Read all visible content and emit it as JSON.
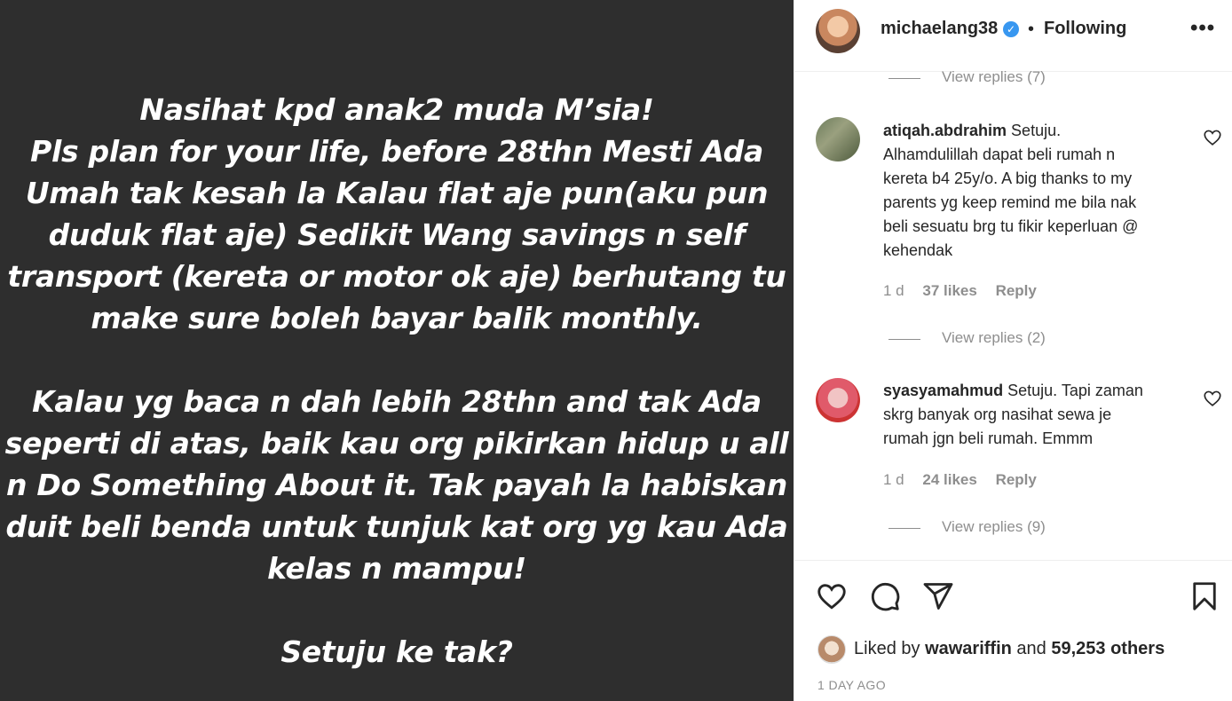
{
  "story": {
    "lines_1": [
      "Nasihat kpd anak2 muda M’sia!",
      "Pls plan for your life, before 28thn Mesti Ada",
      "Umah tak kesah la Kalau flat aje pun(aku pun",
      "duduk flat aje)  Sedikit Wang savings n self",
      "transport (kereta or motor ok aje) berhutang tu",
      "make sure boleh bayar balik monthly."
    ],
    "lines_2": [
      "Kalau yg baca n dah lebih 28thn and tak Ada",
      "seperti di atas, baik kau org pikirkan hidup u all",
      "n Do Something About it. Tak payah la habiskan",
      "duit beli benda untuk tunjuk kat org yg kau Ada",
      "kelas n mampu!"
    ],
    "line_3": "Setuju ke tak?"
  },
  "header": {
    "username": "michaelang38",
    "verified": "✓",
    "separator": "•",
    "follow_label": "Following",
    "more": "•••"
  },
  "top_view_replies": "View replies (7)",
  "comments": [
    {
      "user": "atiqah.abdrahim",
      "lines": [
        "Setuju.",
        "Alhamdulillah dapat beli rumah n",
        "kereta b4 25y/o. A big thanks to my",
        "parents yg keep remind me bila nak",
        "beli sesuatu brg tu fikir keperluan @",
        "kehendak"
      ],
      "age": "1 d",
      "likes": "37 likes",
      "reply": "Reply",
      "view_replies": "View replies (2)"
    },
    {
      "user": "syasyamahmud",
      "lines": [
        "Tapi zaman",
        "skrg banyak org nasihat sewa je",
        "rumah jgn beli rumah. Emmm"
      ],
      "first_word": "Setuju.",
      "age": "1 d",
      "likes": "24 likes",
      "reply": "Reply",
      "view_replies": "View replies (9)"
    }
  ],
  "footer": {
    "liked_by_prefix": "Liked by ",
    "liked_by_user": "wawariffin",
    "liked_by_mid": " and ",
    "liked_by_count": "59,253 others",
    "date": "1 DAY AGO"
  },
  "icons": [
    "heart-icon",
    "comment-icon",
    "share-icon",
    "bookmark-icon",
    "more-icon",
    "verified-icon"
  ]
}
